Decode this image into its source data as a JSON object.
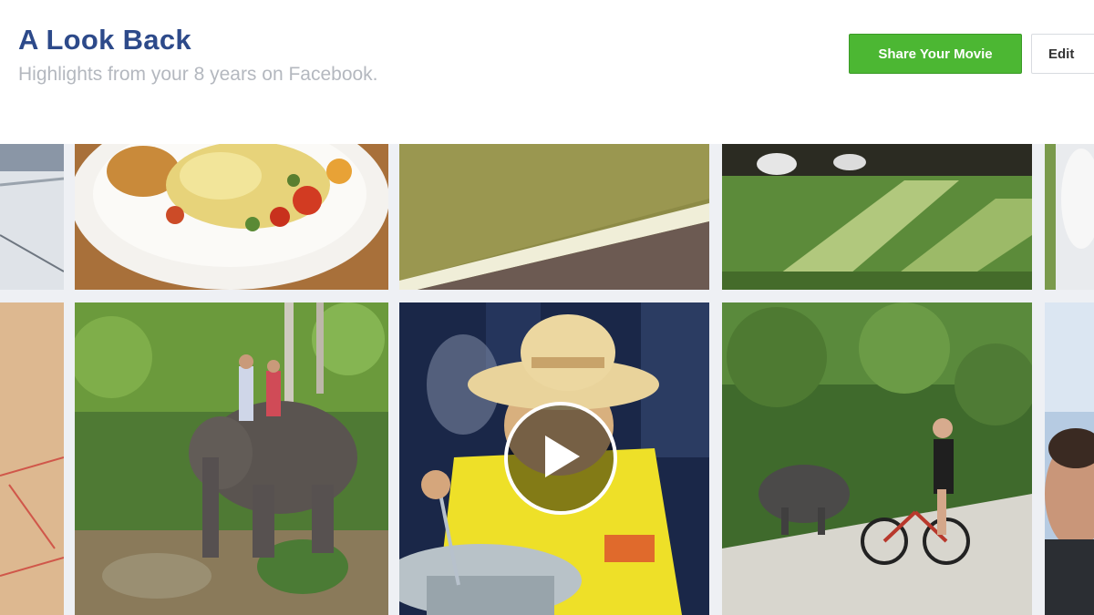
{
  "header": {
    "title": "A Look Back",
    "subtitle": "Highlights from your 8 years on Facebook."
  },
  "actions": {
    "share_label": "Share Your Movie",
    "edit_label": "Edit"
  },
  "icons": {
    "play": "play-icon"
  },
  "colors": {
    "title": "#2d4a8a",
    "share_button": "#4cb733",
    "subtitle": "#b4b8bf"
  }
}
